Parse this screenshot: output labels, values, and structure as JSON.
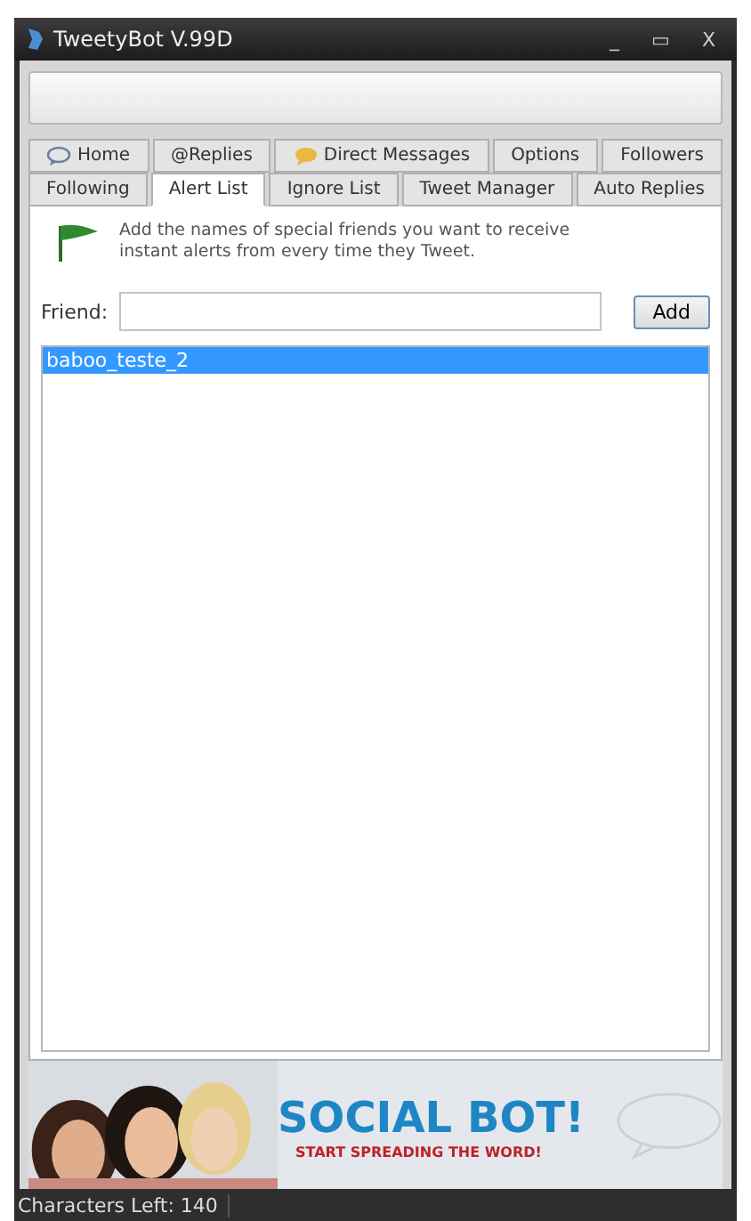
{
  "window": {
    "title": "TweetyBot V.99D",
    "controls": [
      "_",
      "▭",
      "X"
    ]
  },
  "tab_rows": [
    {
      "tabs": [
        {
          "label": "Home",
          "kind": "bubble",
          "selected": false
        },
        {
          "label": "@Replies",
          "kind": "plain",
          "selected": false
        },
        {
          "label": "Direct Messages",
          "kind": "note",
          "selected": false
        },
        {
          "label": "Options",
          "kind": "plain",
          "selected": false
        },
        {
          "label": "Followers",
          "kind": "plain",
          "selected": false
        }
      ]
    },
    {
      "tabs": [
        {
          "label": "Following",
          "kind": "plain",
          "selected": false
        },
        {
          "label": "Alert List",
          "kind": "plain",
          "selected": true
        },
        {
          "label": "Ignore List",
          "kind": "plain",
          "selected": false
        },
        {
          "label": "Tweet Manager",
          "kind": "plain",
          "selected": false
        },
        {
          "label": "Auto Replies",
          "kind": "plain",
          "selected": false
        }
      ]
    }
  ],
  "alert_panel": {
    "description": "Add the names of special friends you want to receive instant alerts from every time they Tweet.",
    "friend_label": "Friend:",
    "add_button": "Add",
    "list": [
      {
        "name": "baboo_teste_2",
        "selected": true
      }
    ]
  },
  "banner": {
    "headline": "SOCIAL BOT!",
    "tagline": "START SPREADING THE WORD!"
  },
  "status_bar": {
    "text": "Characters Left: 140"
  }
}
